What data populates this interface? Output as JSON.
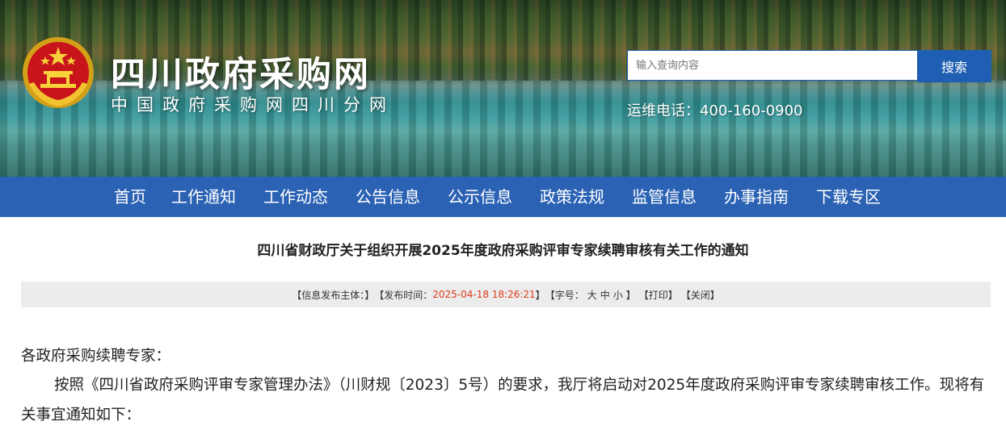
{
  "header": {
    "site_title": "四川政府采购网",
    "site_subtitle": "中国政府采购网四川分网",
    "search": {
      "placeholder": "输入查询内容",
      "button_label": "搜索"
    },
    "hotline": "运维电话：400-160-0900"
  },
  "nav": {
    "items": [
      {
        "label": "首页"
      },
      {
        "label": "工作通知"
      },
      {
        "label": "工作动态"
      },
      {
        "label": "公告信息"
      },
      {
        "label": "公示信息"
      },
      {
        "label": "政策法规"
      },
      {
        "label": "监管信息"
      },
      {
        "label": "办事指南"
      },
      {
        "label": "下载专区"
      }
    ]
  },
  "article": {
    "title": "四川省财政厅关于组织开展2025年度政府采购评审专家续聘审核有关工作的通知",
    "meta": {
      "publisher_label": "【信息发布主体：】",
      "time_label": "【发布时间：",
      "time_value": "2025-04-18 18:26:21",
      "time_close": "】",
      "font_label": "【字号：",
      "font_large": "大",
      "font_medium": "中",
      "font_small": "小",
      "font_close": "】",
      "print": "【打印】",
      "close": "【关闭】"
    },
    "greeting": "各政府采购续聘专家：",
    "paragraph": "按照《四川省政府采购评审专家管理办法》（川财规〔2023〕5号）的要求，我厅将启动对2025年度政府采购评审专家续聘审核工作。现将有关事宜通知如下："
  },
  "colors": {
    "nav_bg": "#2b62b4",
    "search_button": "#1f5fb3",
    "date_highlight": "#e03a1c",
    "meta_bar_bg": "#ececec"
  }
}
